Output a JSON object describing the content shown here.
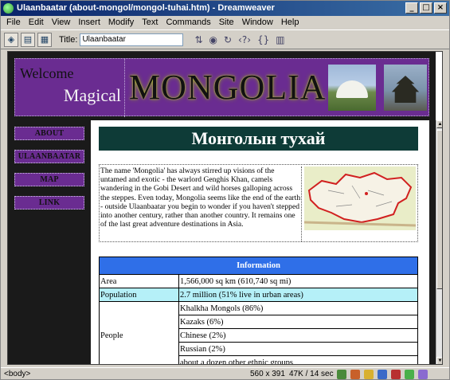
{
  "window": {
    "title": "Ulaanbaatar (about-mongol/mongol-tuhai.htm) - Dreamweaver",
    "controls": {
      "minimize": "_",
      "maximize": "□",
      "close": "×"
    }
  },
  "menu": [
    "File",
    "Edit",
    "View",
    "Insert",
    "Modify",
    "Text",
    "Commands",
    "Site",
    "Window",
    "Help"
  ],
  "toolbar": {
    "title_label": "Title:",
    "title_value": "Ulaanbaatar",
    "icons": [
      "code-view-icon",
      "split-view-icon",
      "design-view-icon",
      "file-management-icon",
      "preview-globe-icon",
      "refresh-icon",
      "reference-icon",
      "code-navigation-icon",
      "view-options-icon"
    ],
    "icon_glyphs": [
      "◈",
      "▤",
      "▦",
      "⇅",
      "◉",
      "↻",
      "‹?›",
      "{}",
      "▥"
    ]
  },
  "banner": {
    "welcome": "Welcome",
    "magical": "Magical",
    "logo": "MONGOLIA"
  },
  "nav": [
    "ABOUT",
    "ULAANBAATAR",
    "MAP",
    "LINK"
  ],
  "content": {
    "heading": "Монголын тухай",
    "intro": "The name 'Mongolia' has always stirred up visions of the untamed and exotic - the warlord Genghis Khan, camels wandering in the Gobi Desert and wild horses galloping across the steppes. Even today, Mongolia seems like the end of the earth - outside Ulaanbaatar you begin to wonder if you haven't stepped into another century, rather than another country. It remains one of the last great adventure destinations in Asia.",
    "table": {
      "header": "Information",
      "rows": [
        {
          "label": "Area",
          "value": "1,566,000 sq km (610,740 sq mi)"
        },
        {
          "label": "Population",
          "value": "2.7 million (51% live in urban areas)"
        }
      ],
      "people_label": "People",
      "people": [
        "Khalkha Mongols (86%)",
        "Kazaks (6%)",
        "Chinese (2%)",
        "Russian (2%)",
        "about a dozen other ethnic groups"
      ]
    }
  },
  "statusbar": {
    "tag": "<body>",
    "dimensions": "560 x 391",
    "download": "47K / 14 sec"
  },
  "colors": {
    "banner": "#6a2c91",
    "heading_bg": "#0e3b37",
    "table_header": "#2f6fe8",
    "highlight_row": "#b5f0f8"
  }
}
